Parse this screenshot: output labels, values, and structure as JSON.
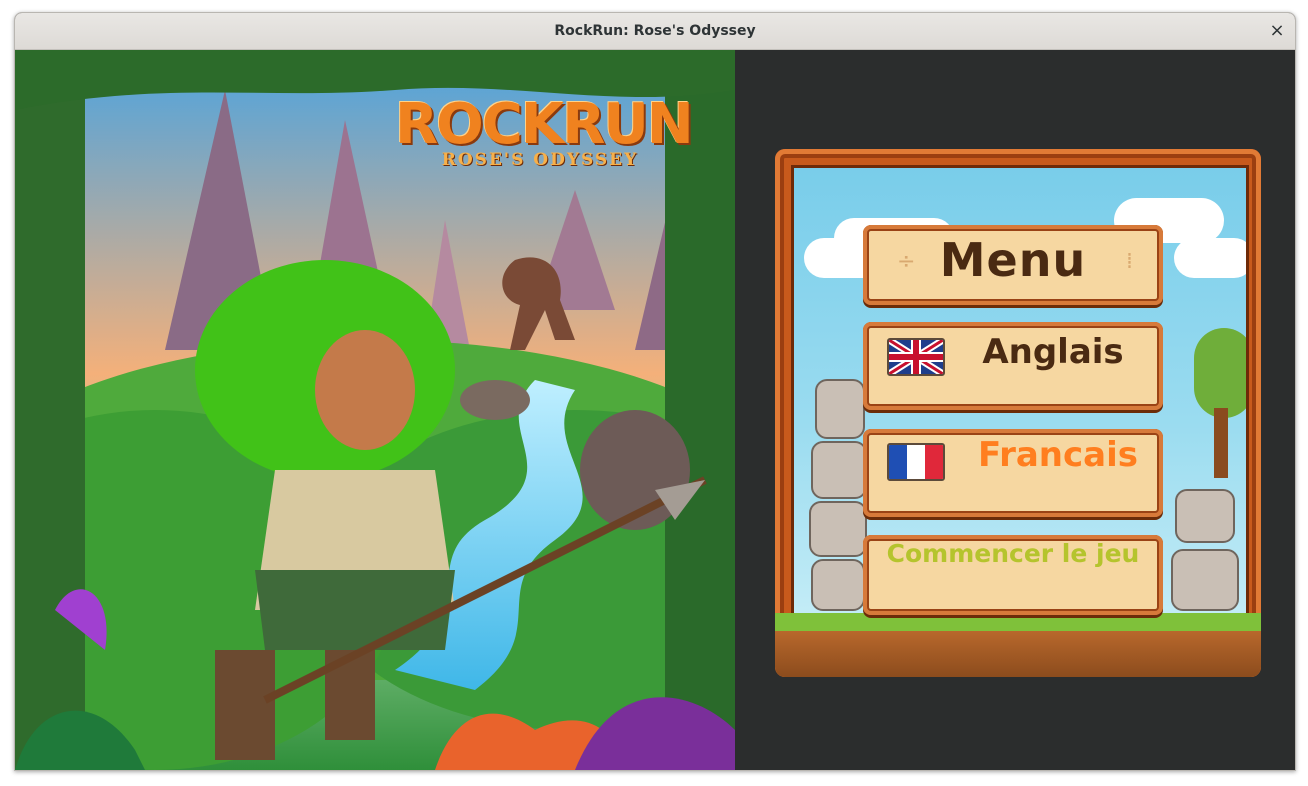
{
  "window": {
    "title": "RockRun: Rose's Odyssey",
    "close_icon": "×"
  },
  "cover": {
    "logo_title": "ROCKRUN",
    "logo_subtitle": "ROSE'S ODYSSEY"
  },
  "menu": {
    "title_button": "Menu",
    "english_button": "Anglais",
    "french_button": "Francais",
    "start_button": "Commencer le jeu"
  },
  "icons": {
    "close": "close-icon",
    "uk_flag": "uk-flag-icon",
    "fr_flag": "france-flag-icon"
  },
  "colors": {
    "francais_label": "#ff7e1f",
    "commencer_label": "#b5c42d",
    "button_fill": "#f6d7a1",
    "frame": "#c85a1c"
  }
}
